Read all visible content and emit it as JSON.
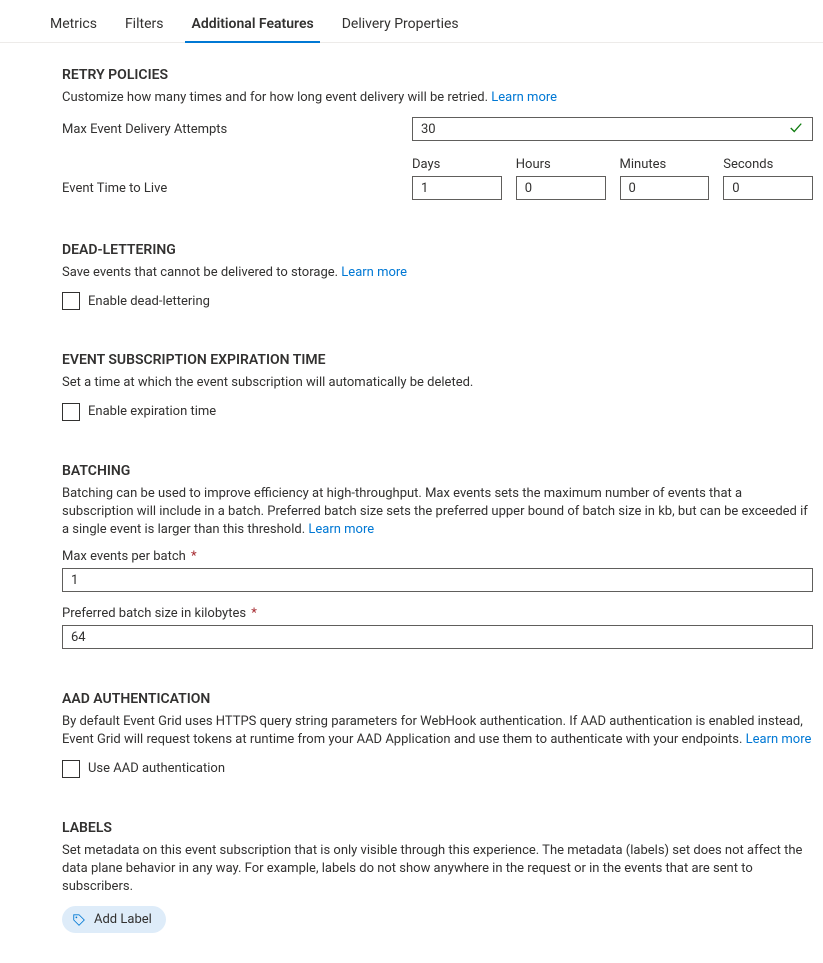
{
  "tabs": {
    "metrics": "Metrics",
    "filters": "Filters",
    "additional_features": "Additional Features",
    "delivery_properties": "Delivery Properties"
  },
  "retry": {
    "title": "RETRY POLICIES",
    "desc": "Customize how many times and for how long event delivery will be retried. ",
    "learn_more": "Learn more",
    "max_attempts_label": "Max Event Delivery Attempts",
    "max_attempts_value": "30",
    "ttl_label": "Event Time to Live",
    "ttl": {
      "days_label": "Days",
      "days_value": "1",
      "hours_label": "Hours",
      "hours_value": "0",
      "minutes_label": "Minutes",
      "minutes_value": "0",
      "seconds_label": "Seconds",
      "seconds_value": "0"
    }
  },
  "deadletter": {
    "title": "DEAD-LETTERING",
    "desc": "Save events that cannot be delivered to storage. ",
    "learn_more": "Learn more",
    "checkbox_label": "Enable dead-lettering"
  },
  "expiration": {
    "title": "EVENT SUBSCRIPTION EXPIRATION TIME",
    "desc": "Set a time at which the event subscription will automatically be deleted.",
    "checkbox_label": "Enable expiration time"
  },
  "batching": {
    "title": "BATCHING",
    "desc": "Batching can be used to improve efficiency at high-throughput. Max events sets the maximum number of events that a subscription will include in a batch. Preferred batch size sets the preferred upper bound of batch size in kb, but can be exceeded if a single event is larger than this threshold. ",
    "learn_more": "Learn more",
    "max_events_label": "Max events per batch",
    "max_events_value": "1",
    "preferred_size_label": "Preferred batch size in kilobytes",
    "preferred_size_value": "64"
  },
  "aad": {
    "title": "AAD AUTHENTICATION",
    "desc": "By default Event Grid uses HTTPS query string parameters for WebHook authentication. If AAD authentication is enabled instead, Event Grid will request tokens at runtime from your AAD Application and use them to authenticate with your endpoints. ",
    "learn_more": "Learn more",
    "checkbox_label": "Use AAD authentication"
  },
  "labels": {
    "title": "LABELS",
    "desc": "Set metadata on this event subscription that is only visible through this experience. The metadata (labels) set does not affect the data plane behavior in any way. For example, labels do not show anywhere in the request or in the events that are sent to subscribers.",
    "add_button": "Add Label"
  },
  "required_indicator": "*"
}
